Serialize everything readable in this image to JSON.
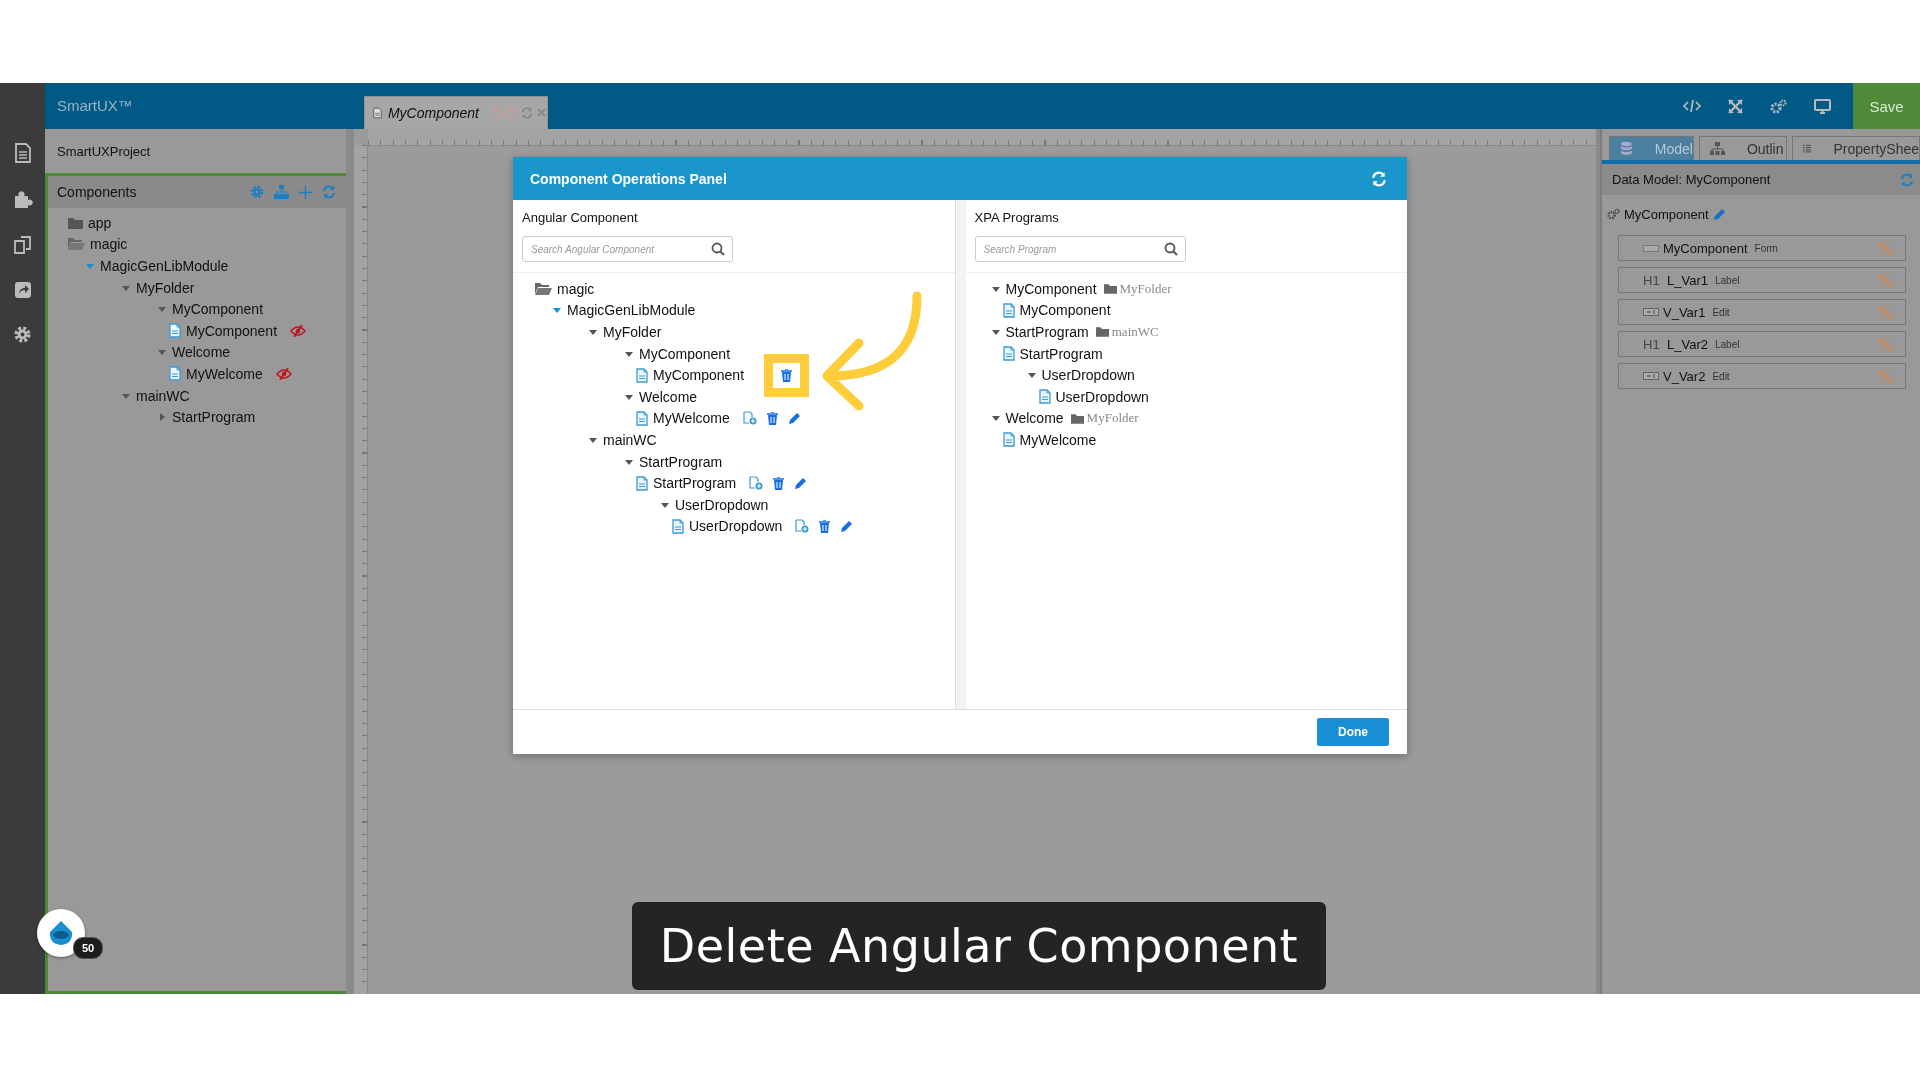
{
  "app": {
    "title": "SmartUX™"
  },
  "editor_tab": {
    "label": "MyComponent"
  },
  "toolbar": {
    "save": "Save"
  },
  "project": {
    "name": "SmartUXProject"
  },
  "components_panel": {
    "title": "Components",
    "tree": [
      {
        "label": "app",
        "kind": "folder"
      },
      {
        "label": "magic",
        "kind": "open-folder",
        "expanded": true,
        "children": [
          {
            "label": "MagicGenLibModule",
            "kind": "module",
            "expanded": true,
            "children": [
              {
                "label": "MyFolder",
                "kind": "group",
                "expanded": true,
                "children": [
                  {
                    "label": "MyComponent",
                    "kind": "group",
                    "expanded": true,
                    "children": [
                      {
                        "label": "MyComponent",
                        "kind": "file",
                        "hidden_marker": true
                      }
                    ]
                  },
                  {
                    "label": "Welcome",
                    "kind": "group",
                    "expanded": true,
                    "children": [
                      {
                        "label": "MyWelcome",
                        "kind": "file",
                        "hidden_marker": true
                      }
                    ]
                  }
                ]
              },
              {
                "label": "mainWC",
                "kind": "group",
                "expanded": true,
                "children": [
                  {
                    "label": "StartProgram",
                    "kind": "group",
                    "expanded": false
                  }
                ]
              }
            ]
          }
        ]
      }
    ]
  },
  "dialog": {
    "title": "Component Operations Panel",
    "angular": {
      "title": "Angular Component",
      "placeholder": "Search Angular Component",
      "tree": [
        {
          "label": "magic",
          "kind": "open-folder",
          "expanded": true,
          "children": [
            {
              "label": "MagicGenLibModule",
              "kind": "module",
              "expanded": true,
              "children": [
                {
                  "label": "MyFolder",
                  "kind": "group",
                  "expanded": true,
                  "children": [
                    {
                      "label": "MyComponent",
                      "kind": "group",
                      "expanded": true,
                      "children": [
                        {
                          "label": "MyComponent",
                          "kind": "file",
                          "highlighted": true
                        }
                      ]
                    },
                    {
                      "label": "Welcome",
                      "kind": "group",
                      "expanded": true,
                      "children": [
                        {
                          "label": "MyWelcome",
                          "kind": "file",
                          "highlighted": false
                        }
                      ]
                    }
                  ]
                },
                {
                  "label": "mainWC",
                  "kind": "group",
                  "expanded": true,
                  "children": [
                    {
                      "label": "StartProgram",
                      "kind": "group",
                      "expanded": true,
                      "children": [
                        {
                          "label": "StartProgram",
                          "kind": "file",
                          "highlighted": false
                        },
                        {
                          "label": "UserDropdown",
                          "kind": "group",
                          "expanded": true,
                          "children": [
                            {
                              "label": "UserDropdown",
                              "kind": "file",
                              "highlighted": false
                            }
                          ]
                        }
                      ]
                    }
                  ]
                }
              ]
            }
          ]
        }
      ]
    },
    "xpa": {
      "title": "XPA Programs",
      "placeholder": "Search Program",
      "tree": [
        {
          "label": "MyComponent",
          "kind": "group",
          "expanded": true,
          "folder": "MyFolder",
          "children": [
            {
              "label": "MyComponent",
              "kind": "file"
            }
          ]
        },
        {
          "label": "StartProgram",
          "kind": "group",
          "expanded": true,
          "folder": "mainWC",
          "children": [
            {
              "label": "StartProgram",
              "kind": "file"
            },
            {
              "label": "UserDropdown",
              "kind": "group",
              "expanded": true,
              "children": [
                {
                  "label": "UserDropdown",
                  "kind": "file"
                }
              ]
            }
          ]
        },
        {
          "label": "Welcome",
          "kind": "group",
          "expanded": true,
          "folder": "MyFolder",
          "children": [
            {
              "label": "MyWelcome",
              "kind": "file"
            }
          ]
        }
      ]
    },
    "done": "Done"
  },
  "data_model": {
    "tabs": [
      {
        "label": "Model",
        "selected": true,
        "kind": "models"
      },
      {
        "label": "Outlin",
        "selected": false,
        "kind": "outline"
      },
      {
        "label": "PropertyShee",
        "selected": false,
        "kind": "properties"
      }
    ],
    "title": "Data Model: MyComponent",
    "model": "MyComponent",
    "fields": [
      {
        "name": "MyComponent",
        "type": "Form",
        "kind": "form"
      },
      {
        "name": "L_Var1",
        "type": "Label",
        "kind": "label",
        "marker": "H1"
      },
      {
        "name": "V_Var1",
        "type": "Edit",
        "kind": "edit"
      },
      {
        "name": "L_Var2",
        "type": "Label",
        "kind": "label",
        "marker": "H1"
      },
      {
        "name": "V_Var2",
        "type": "Edit",
        "kind": "edit"
      }
    ]
  },
  "caption": "Delete Angular Component",
  "badge": {
    "count": "50"
  }
}
